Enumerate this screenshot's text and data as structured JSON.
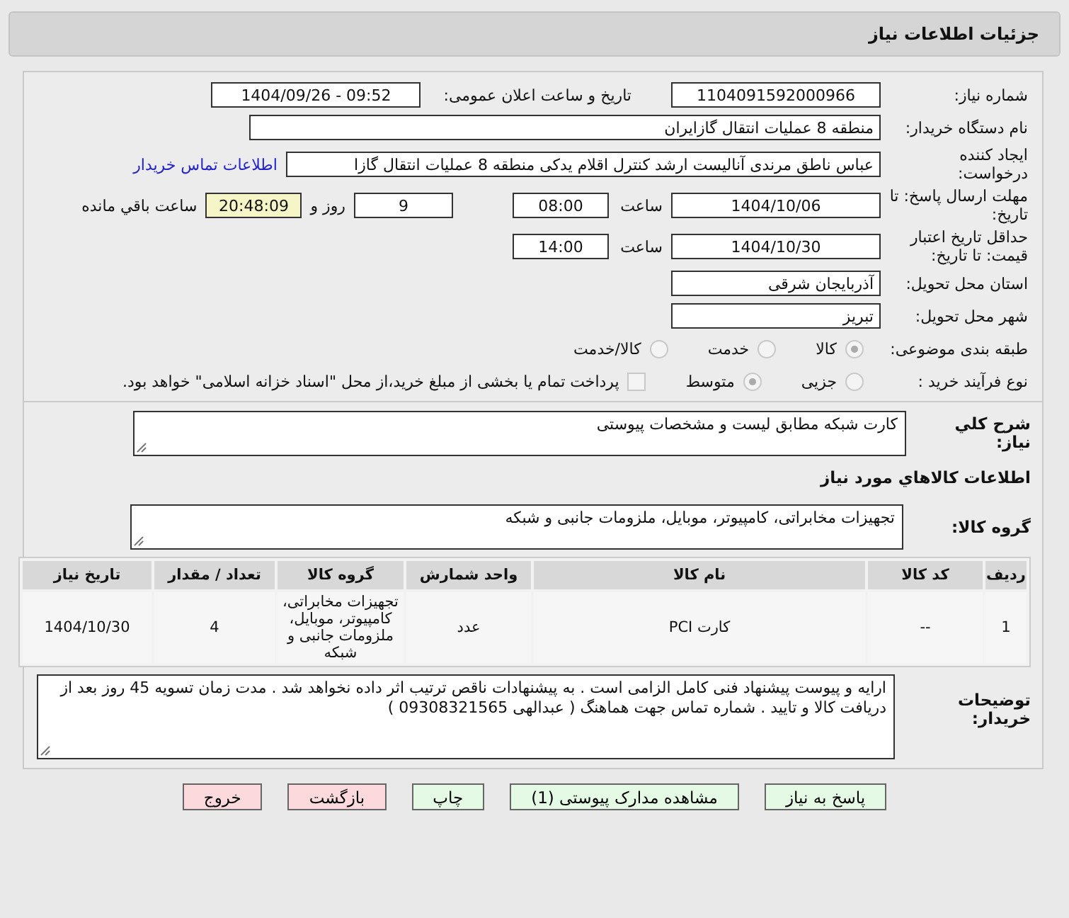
{
  "header": {
    "title": "جزئیات اطلاعات نیاز"
  },
  "need_number": {
    "label": "شماره نیاز:",
    "value": "1104091592000966"
  },
  "announce": {
    "label": "تاریخ و ساعت اعلان عمومی:",
    "value": "1404/09/26 - 09:52"
  },
  "buyer": {
    "label": "نام دستگاه خریدار:",
    "value": "منطقه 8 عملیات انتقال گازایران"
  },
  "requester": {
    "label": "ایجاد کننده درخواست:",
    "value": "عباس ناطق مرندی آنالیست ارشد کنترل اقلام یدکی منطقه 8 عملیات انتقال گازا",
    "link": "اطلاعات تماس خریدار"
  },
  "deadline": {
    "label": "مهلت ارسال پاسخ: تا تاریخ:",
    "date": "1404/10/06",
    "time_label": "ساعت",
    "time": "08:00",
    "days": "9",
    "days_label": "روز و",
    "remaining": "20:48:09",
    "remaining_label": "ساعت باقي مانده"
  },
  "validity": {
    "label": "حداقل تاریخ اعتبار قیمت: تا تاریخ:",
    "date": "1404/10/30",
    "time_label": "ساعت",
    "time": "14:00"
  },
  "province": {
    "label": "استان محل تحویل:",
    "value": "آذربایجان شرقی"
  },
  "city": {
    "label": "شهر محل تحویل:",
    "value": "تبریز"
  },
  "category": {
    "label": "طبقه بندی موضوعی:",
    "options": [
      {
        "label": "کالا",
        "selected": true
      },
      {
        "label": "خدمت",
        "selected": false
      },
      {
        "label": "کالا/خدمت",
        "selected": false
      }
    ]
  },
  "process": {
    "label": "نوع فرآیند خرید :",
    "options": [
      {
        "label": "جزیی",
        "selected": false
      },
      {
        "label": "متوسط",
        "selected": true
      }
    ],
    "checkbox": {
      "label": "پرداخت تمام یا بخشی از مبلغ خرید،از محل \"اسناد خزانه اسلامی\" خواهد بود.",
      "checked": false
    }
  },
  "summary": {
    "label": "شرح کلي نياز:",
    "value": "کارت شبکه مطابق لیست و مشخصات پیوستی"
  },
  "goods_heading": "اطلاعات كالاهاي مورد نياز",
  "goods_group": {
    "label": "گروه کالا:",
    "value": "تجهیزات مخابراتی، کامپیوتر، موبایل، ملزومات جانبی و شبکه"
  },
  "table": {
    "columns": [
      "ردیف",
      "کد کالا",
      "نام کالا",
      "واحد شمارش",
      "گروه کالا",
      "تعداد / مقدار",
      "تاریخ نیاز"
    ],
    "rows": [
      [
        "1",
        "--",
        "کارت PCI",
        "عدد",
        "تجهیزات مخابراتی، کامپیوتر، موبایل، ملزومات جانبی و شبکه",
        "4",
        "1404/10/30"
      ]
    ]
  },
  "buyer_notes": {
    "label": "توضیحات خریدار:",
    "value": "ارایه و پیوست پیشنهاد فنی کامل الزامی است . به پیشنهادات ناقص ترتیب اثر داده نخواهد شد . مدت زمان تسویه 45 روز بعد از دریافت کالا و تایید . شماره تماس جهت هماهنگ ( عبدالهی 09308321565 )"
  },
  "buttons": [
    {
      "label": "پاسخ به نیاز",
      "kind": "action"
    },
    {
      "label": "مشاهده مدارک پیوستی (1)",
      "kind": "action"
    },
    {
      "label": "چاپ",
      "kind": "action"
    },
    {
      "label": "بازگشت",
      "kind": "exit"
    },
    {
      "label": "خروج",
      "kind": "exit"
    }
  ]
}
